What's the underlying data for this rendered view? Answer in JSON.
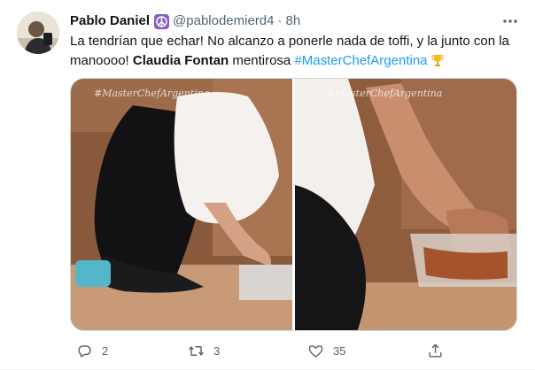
{
  "tweet": {
    "author": {
      "display_name": "Pablo Daniel",
      "badge_icon": "peace-emoji-icon",
      "handle": "@pablodemierd4",
      "separator": "·",
      "time": "8h"
    },
    "text": {
      "line1": "La tendrían que echar! No alcanzo a ponerle nada de toffi, y la junto con la",
      "line2_start": "manoooo!",
      "mention": "Claudia Fontan",
      "middle": "mentirosa",
      "hashtag": "#MasterChefArgentina",
      "hashtag_icon": "trophy-icon"
    },
    "media": {
      "watermark_left": "#MasterChefArgentina",
      "watermark_right": "#MasterChefArgentina"
    },
    "actions": {
      "reply_count": "2",
      "retweet_count": "3",
      "like_count": "35"
    },
    "colors": {
      "link": "#1d9bf0",
      "secondary_text": "#536471",
      "primary_text": "#0f1419"
    }
  }
}
